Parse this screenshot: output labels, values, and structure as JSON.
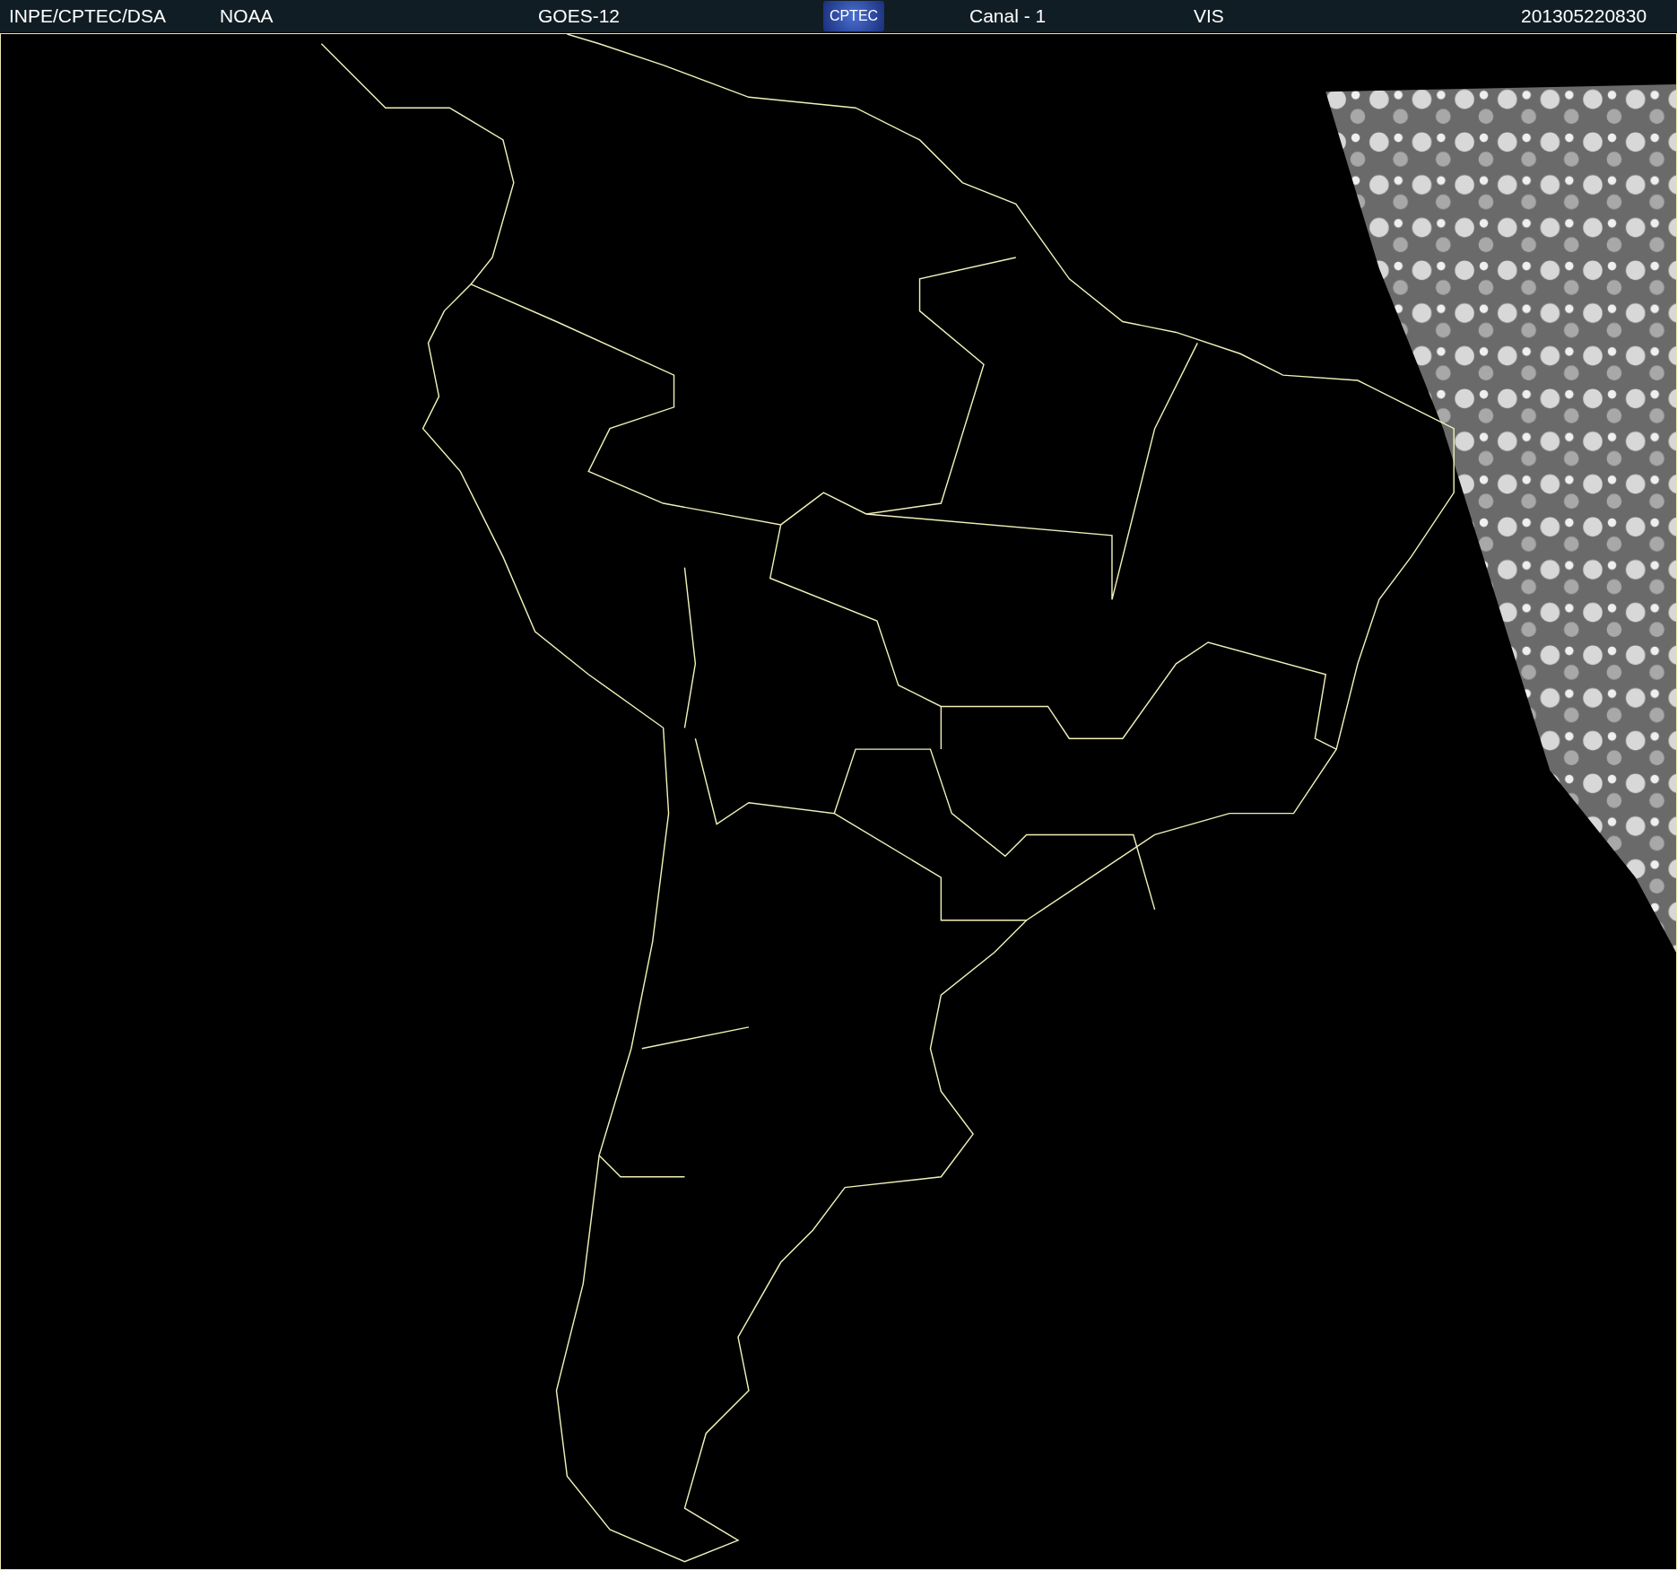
{
  "header": {
    "source": "INPE/CPTEC/DSA",
    "agency": "NOAA",
    "satellite": "GOES-12",
    "logo": "CPTEC",
    "channel": "Canal - 1",
    "band": "VIS",
    "timestamp": "201305220830"
  }
}
